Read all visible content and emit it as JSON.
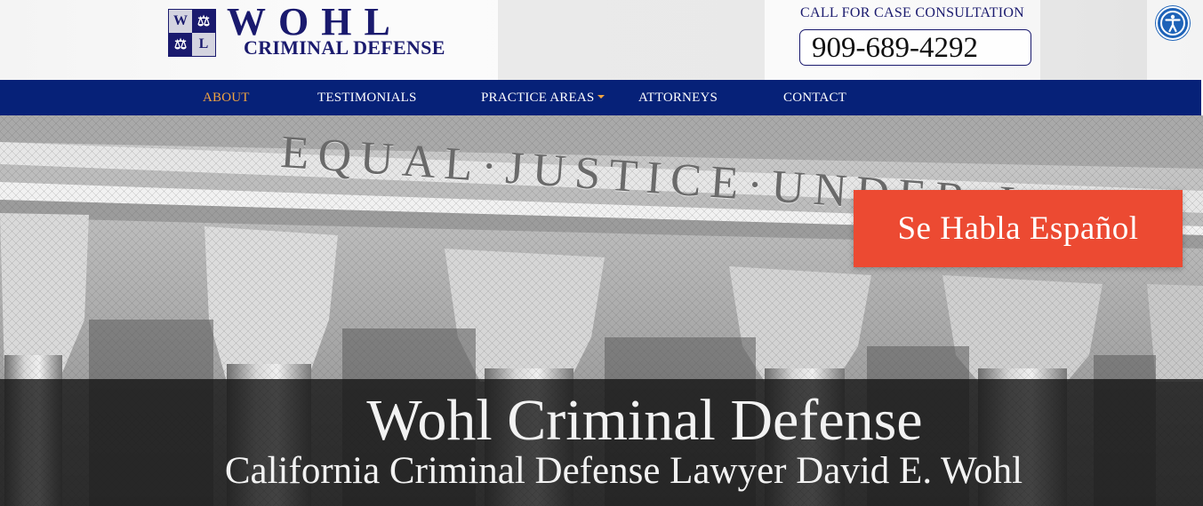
{
  "header": {
    "logo": {
      "letters": [
        "W",
        "⚖",
        "⚖",
        "L"
      ],
      "word": "WOHL",
      "subtitle": "CRIMINAL DEFENSE"
    },
    "call_label": "CALL FOR CASE CONSULTATION",
    "phone": "909-689-4292",
    "accessibility_icon": "accessibility-icon"
  },
  "nav": {
    "items": [
      {
        "label": "ABOUT",
        "active": true
      },
      {
        "label": "TESTIMONIALS"
      },
      {
        "label": "PRACTICE AREAS",
        "dropdown": true
      },
      {
        "label": "ATTORNEYS"
      },
      {
        "label": "CONTACT"
      }
    ]
  },
  "hero": {
    "inscription": "EQUAL·JUSTICE·UNDER·LAW",
    "espanol_label": "Se Habla Español",
    "title": "Wohl Criminal Defense",
    "subtitle": "California Criminal Defense Lawyer David E. Wohl"
  },
  "colors": {
    "brand_navy": "#1a1a6e",
    "nav_bg": "#062178",
    "nav_active": "#f2a541",
    "espanol_bg": "#ec4a32",
    "access_blue": "#1e63b8"
  }
}
